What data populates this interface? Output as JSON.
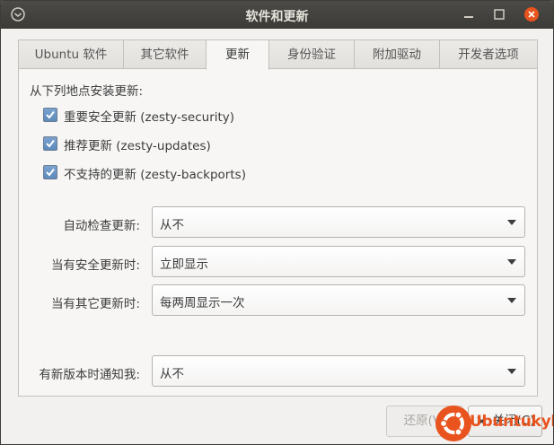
{
  "window": {
    "title": "软件和更新"
  },
  "tabs": [
    {
      "label": "Ubuntu 软件",
      "active": false
    },
    {
      "label": "其它软件",
      "active": false
    },
    {
      "label": "更新",
      "active": true
    },
    {
      "label": "身份验证",
      "active": false
    },
    {
      "label": "附加驱动",
      "active": false
    },
    {
      "label": "开发者选项",
      "active": false
    }
  ],
  "updates": {
    "section_label": "从下列地点安装更新:",
    "sources": [
      {
        "label": "重要安全更新 (zesty-security)",
        "checked": true
      },
      {
        "label": "推荐更新 (zesty-updates)",
        "checked": true
      },
      {
        "label": "不支持的更新 (zesty-backports)",
        "checked": true
      }
    ],
    "settings": [
      {
        "label": "自动检查更新:",
        "value": "从不"
      },
      {
        "label": "当有安全更新时:",
        "value": "立即显示"
      },
      {
        "label": "当有其它更新时:",
        "value": "每两周显示一次"
      }
    ],
    "notify": {
      "label": "有新版本时通知我:",
      "value": "从不"
    }
  },
  "buttons": {
    "revert": "还原(V)",
    "close": "关闭(C)"
  },
  "watermark": {
    "text": "Ubuntukylin"
  },
  "colors": {
    "titlebar": "#3c3b37",
    "checkbox": "#6a94c4",
    "watermark": "#e9541e"
  }
}
